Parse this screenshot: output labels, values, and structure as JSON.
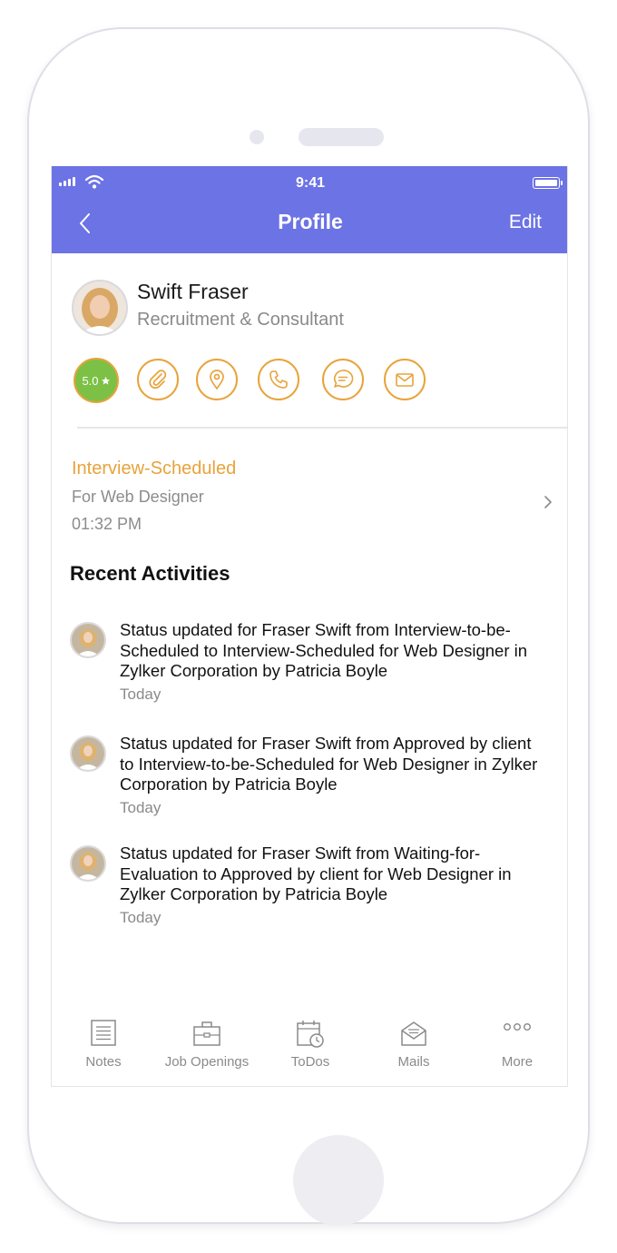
{
  "status_bar": {
    "time": "9:41"
  },
  "header": {
    "title": "Profile",
    "edit_label": "Edit"
  },
  "profile": {
    "name": "Swift Fraser",
    "role": "Recruitment & Consultant",
    "rating": "5.0"
  },
  "actions": [
    {
      "icon": "paperclip-icon"
    },
    {
      "icon": "location-pin-icon"
    },
    {
      "icon": "phone-icon"
    },
    {
      "icon": "chat-icon"
    },
    {
      "icon": "mail-icon"
    }
  ],
  "interview": {
    "status": "Interview-Scheduled",
    "job": "For Web Designer",
    "time": "01:32 PM"
  },
  "recent_activities": {
    "title": "Recent Activities",
    "items": [
      {
        "text": "Status updated for Fraser Swift from Interview-to-be-Scheduled to Interview-Scheduled for Web Designer in Zylker Corporation by Patricia Boyle",
        "time": "Today"
      },
      {
        "text": "Status updated for Fraser Swift from Approved by client to Interview-to-be-Scheduled for Web Designer in Zylker Corporation by Patricia Boyle",
        "time": "Today"
      },
      {
        "text": "Status updated for Fraser Swift from Waiting-for-Evaluation to Approved by client for Web Designer in Zylker Corporation by Patricia Boyle",
        "time": "Today"
      }
    ]
  },
  "tab_bar": [
    {
      "label": "Notes",
      "icon": "notes-icon"
    },
    {
      "label": "Job Openings",
      "icon": "briefcase-icon"
    },
    {
      "label": "ToDos",
      "icon": "calendar-clock-icon"
    },
    {
      "label": "Mails",
      "icon": "envelope-icon"
    },
    {
      "label": "More",
      "icon": "more-dots-icon"
    }
  ],
  "colors": {
    "header": "#6c73e5",
    "accent": "#e8a33a",
    "rating_green": "#7cc146",
    "muted_text": "#8a8a8a"
  }
}
